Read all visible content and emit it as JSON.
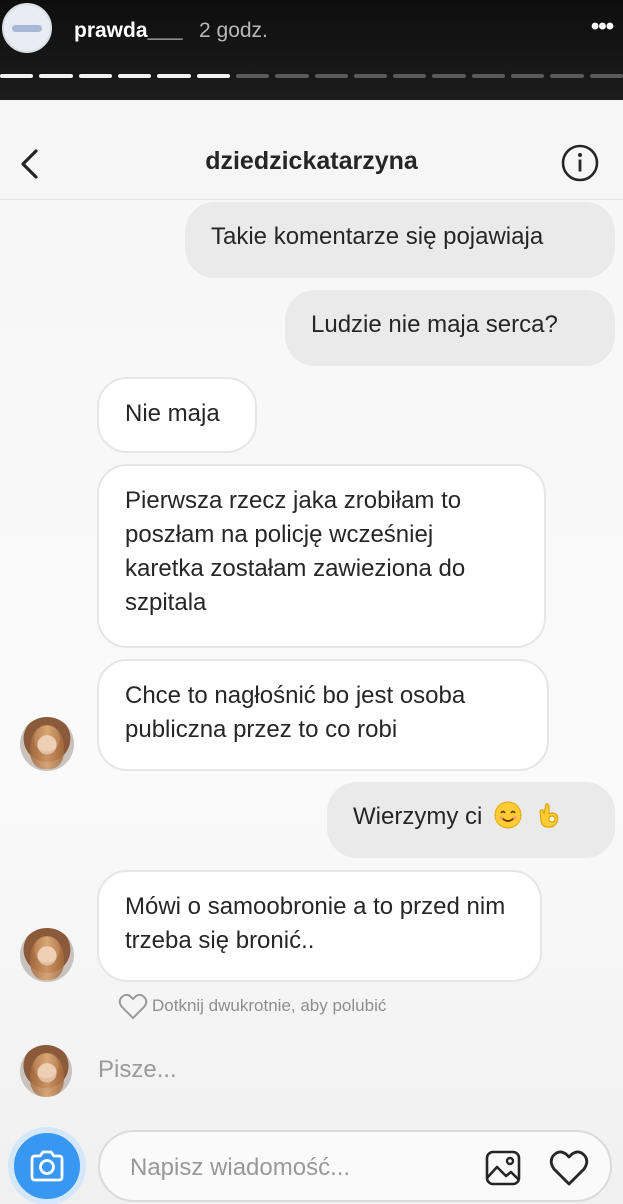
{
  "story": {
    "username": "prawda___",
    "time": "2 godz.",
    "more_label": "•••",
    "progress": {
      "total": 16,
      "completed": 6
    }
  },
  "chat": {
    "title": "dziedzickatarzyna",
    "messages": [
      {
        "direction": "out",
        "text": "Takie komentarze się pojawiaja"
      },
      {
        "direction": "out",
        "text": "Ludzie nie maja serca?"
      },
      {
        "direction": "in",
        "text": "Nie maja"
      },
      {
        "direction": "in",
        "text": "Pierwsza rzecz jaka zrobiłam to poszłam na policję wcześniej karetka zostałam zawieziona do szpitala"
      },
      {
        "direction": "in",
        "text": "Chce to nagłośnić bo jest osoba publiczna przez to co robi"
      },
      {
        "direction": "out",
        "text": "Wierzymy ci",
        "emojis": [
          "smiling-face-emoji",
          "ok-hand-emoji"
        ]
      },
      {
        "direction": "in",
        "text": "Mówi o samoobronie a to przed nim trzeba się bronić.."
      }
    ],
    "like_hint": "Dotknij dwukrotnie, aby polubić",
    "typing": "Pisze..."
  },
  "composer": {
    "placeholder": "Napisz wiadomość..."
  },
  "colors": {
    "accent": "#3897f0",
    "bubble_out": "#eaeaea",
    "bubble_in": "#ffffff"
  },
  "icons": [
    "back-arrow-icon",
    "info-icon",
    "camera-icon",
    "gallery-icon",
    "heart-icon"
  ]
}
